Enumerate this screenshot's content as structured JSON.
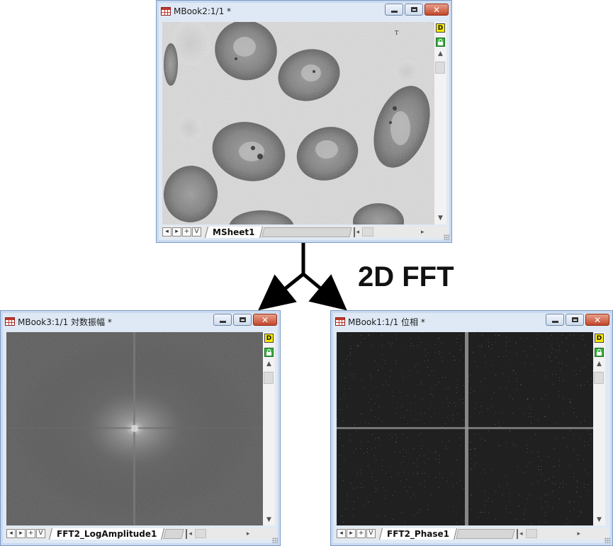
{
  "annotation": {
    "label": "2D FFT"
  },
  "windows": [
    {
      "id": "source",
      "title": "MBook2:1/1  *",
      "sheet_tab": "MSheet1",
      "image_content": "grayscale micrograph of oval cells",
      "marker_char": "T"
    },
    {
      "id": "amplitude",
      "title": "MBook3:1/1 対数振幅 *",
      "sheet_tab": "FFT2_LogAmplitude1",
      "image_content": "log amplitude spectrum"
    },
    {
      "id": "phase",
      "title": "MBook1:1/1 位相 *",
      "sheet_tab": "FFT2_Phase1",
      "image_content": "phase noise pattern"
    }
  ],
  "controls": {
    "minimize": "",
    "maximize": "",
    "close": "✕",
    "badge_d": "D",
    "nav_first": "◂",
    "nav_next": "▸",
    "nav_add": "+",
    "nav_down": "V",
    "scroll_up": "▲",
    "scroll_down": "▼",
    "scroll_left": "◂",
    "scroll_right": "▸"
  },
  "colors": {
    "accent_close": "#c2472b",
    "badge_d": "#f6e900",
    "badge_lock": "#3cb043"
  }
}
